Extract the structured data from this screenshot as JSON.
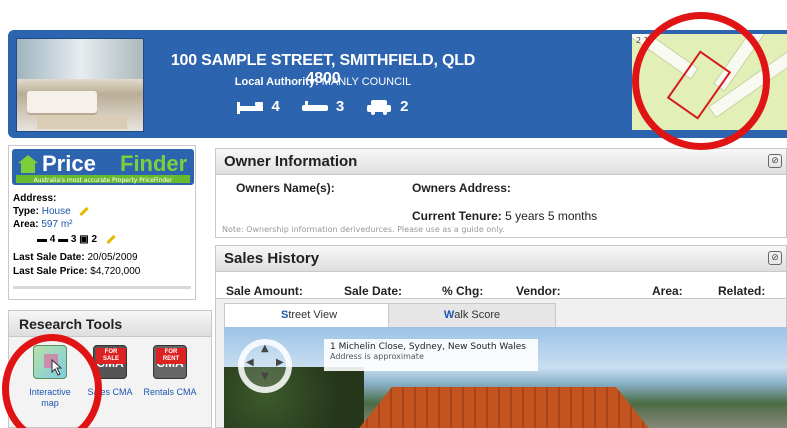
{
  "header": {
    "address": "100 SAMPLE STREET, SMITHFIELD, QLD 4800",
    "local_authority_label": "Local Authority:",
    "local_authority": "MANLY COUNCIL",
    "beds": "4",
    "baths": "3",
    "cars": "2",
    "map_scale": "2 14"
  },
  "pricefinder": {
    "logo_price": "Price",
    "logo_finder": "Finder",
    "tagline": "Australia's most accurate Property PriceFinder",
    "address_label": "Address:",
    "type_label": "Type:",
    "type_value": "House",
    "area_label": "Area:",
    "area_value": "597 m²",
    "beds": "4",
    "baths": "3",
    "cars": "2",
    "last_sale_date_label": "Last Sale Date:",
    "last_sale_date": "20/05/2009",
    "last_sale_price_label": "Last Sale Price:",
    "last_sale_price": "$4,720,000"
  },
  "research": {
    "title": "Research Tools",
    "tools": [
      {
        "label": "Interactive map"
      },
      {
        "label": "Sales CMA",
        "tag": "FOR SALE",
        "icon_text": "CMA"
      },
      {
        "label": "Rentals CMA",
        "tag": "FOR RENT",
        "icon_text": "CMA"
      }
    ]
  },
  "owner": {
    "title": "Owner Information",
    "owners_name_label": "Owners Name(s):",
    "owners_address_label": "Owners Address:",
    "tenure_label": "Current Tenure:",
    "tenure_value": "5 years 5 months",
    "note": "Note: Ownership information derivedurces. Please use as a guide only."
  },
  "sales": {
    "title": "Sales History",
    "columns": [
      "Sale Amount:",
      "Sale Date:",
      "% Chg:",
      "Vendor:",
      "Area:",
      "Related:"
    ]
  },
  "tabs": [
    {
      "first": "S",
      "rest": "treet View"
    },
    {
      "first": "W",
      "rest": "alk Score"
    }
  ],
  "street_view": {
    "address_line": "1 Michelin Close, Sydney, New South Wales",
    "approx": "Address is approximate"
  },
  "colors": {
    "header_blue": "#2d64b0",
    "link_blue": "#1c56b0",
    "highlight_red": "#e01414",
    "finder_green": "#7ccf3a"
  }
}
